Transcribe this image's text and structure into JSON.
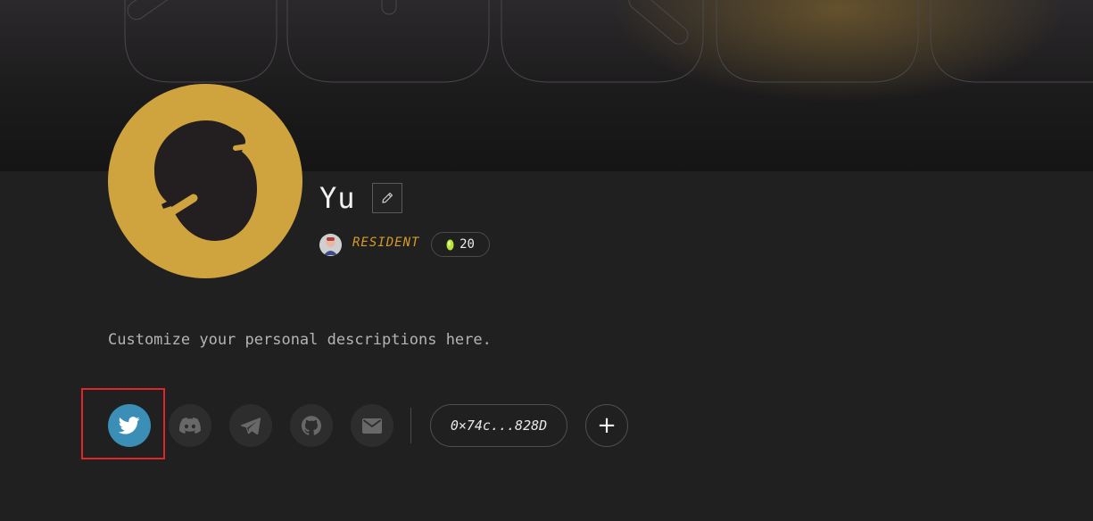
{
  "profile": {
    "name": "Yu",
    "role": "RESIDENT",
    "points": "20",
    "description": "Customize your personal descriptions here."
  },
  "social": {
    "items": [
      {
        "name": "twitter",
        "icon": "twitter-icon",
        "active": true
      },
      {
        "name": "discord",
        "icon": "discord-icon",
        "active": false
      },
      {
        "name": "telegram",
        "icon": "telegram-icon",
        "active": false
      },
      {
        "name": "github",
        "icon": "github-icon",
        "active": false
      },
      {
        "name": "email",
        "icon": "mail-icon",
        "active": false
      }
    ],
    "wallet": "0×74c...828D",
    "add_label": "+"
  },
  "colors": {
    "accent_gold": "#cfa33e",
    "role_orange": "#d69b28",
    "twitter_blue": "#3b8fb6",
    "highlight_red": "#e0262b"
  }
}
